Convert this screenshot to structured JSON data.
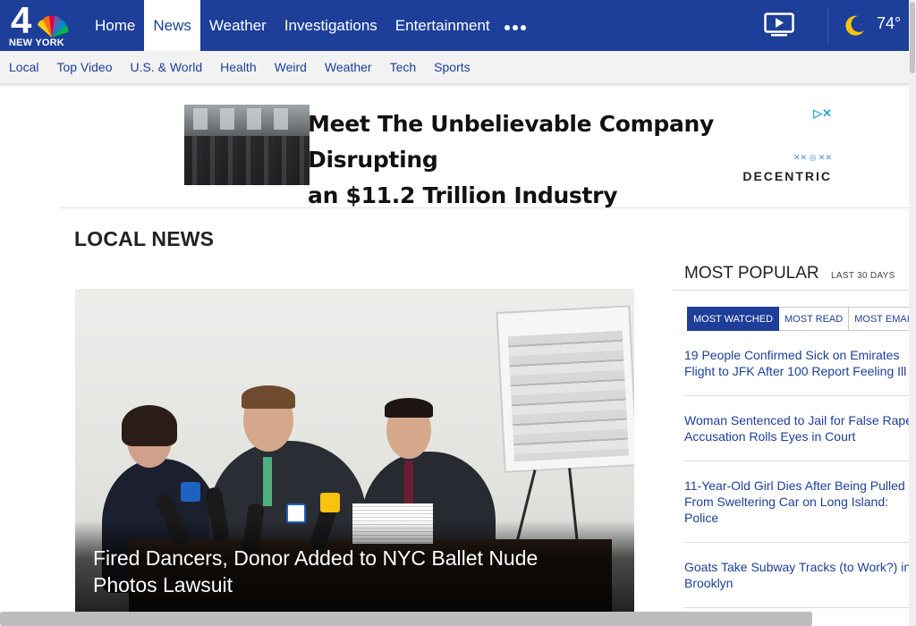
{
  "header": {
    "logo_number": "4",
    "logo_city": "NEW YORK",
    "nav": [
      {
        "label": "Home",
        "active": false
      },
      {
        "label": "News",
        "active": true
      },
      {
        "label": "Weather",
        "active": false
      },
      {
        "label": "Investigations",
        "active": false
      },
      {
        "label": "Entertainment",
        "active": false
      }
    ],
    "more_icon": "more-dots-icon",
    "video_icon": "video-play-icon",
    "weather_icon": "moon-icon",
    "temperature": "74°"
  },
  "subnav": [
    "Local",
    "Top Video",
    "U.S. & World",
    "Health",
    "Weird",
    "Weather",
    "Tech",
    "Sports"
  ],
  "ad": {
    "headline_line1": "Meet The Unbelievable Company Disrupting",
    "headline_line2": "an $11.2 Trillion Industry",
    "choices_icon": "adchoices-icon",
    "brand": "DECENTRIC"
  },
  "section_title": "LOCAL NEWS",
  "hero": {
    "caption": "Fired Dancers, Donor Added to NYC Ballet Nude Photos Lawsuit"
  },
  "popular": {
    "title": "MOST POPULAR",
    "subtitle": "LAST 30 DAYS",
    "tabs": [
      {
        "label": "MOST WATCHED",
        "active": true
      },
      {
        "label": "MOST READ",
        "active": false
      },
      {
        "label": "MOST EMAILED",
        "active": false
      }
    ],
    "items": [
      {
        "line1": "19 People Confirmed Sick on Emirates",
        "line2": "Flight to JFK After 100 Report Feeling Ill",
        "line3": ""
      },
      {
        "line1": "Woman Sentenced to Jail for False Rape",
        "line2": "Accusation Rolls Eyes in Court",
        "line3": ""
      },
      {
        "line1": "11-Year-Old Girl Dies After Being Pulled",
        "line2": "From Sweltering Car on Long Island:",
        "line3": "Police"
      },
      {
        "line1": "Goats Take Subway Tracks (to Work?) in",
        "line2": "Brooklyn",
        "line3": ""
      }
    ]
  },
  "colors": {
    "brand_blue": "#1d3f99",
    "link_blue": "#1d3f99"
  }
}
